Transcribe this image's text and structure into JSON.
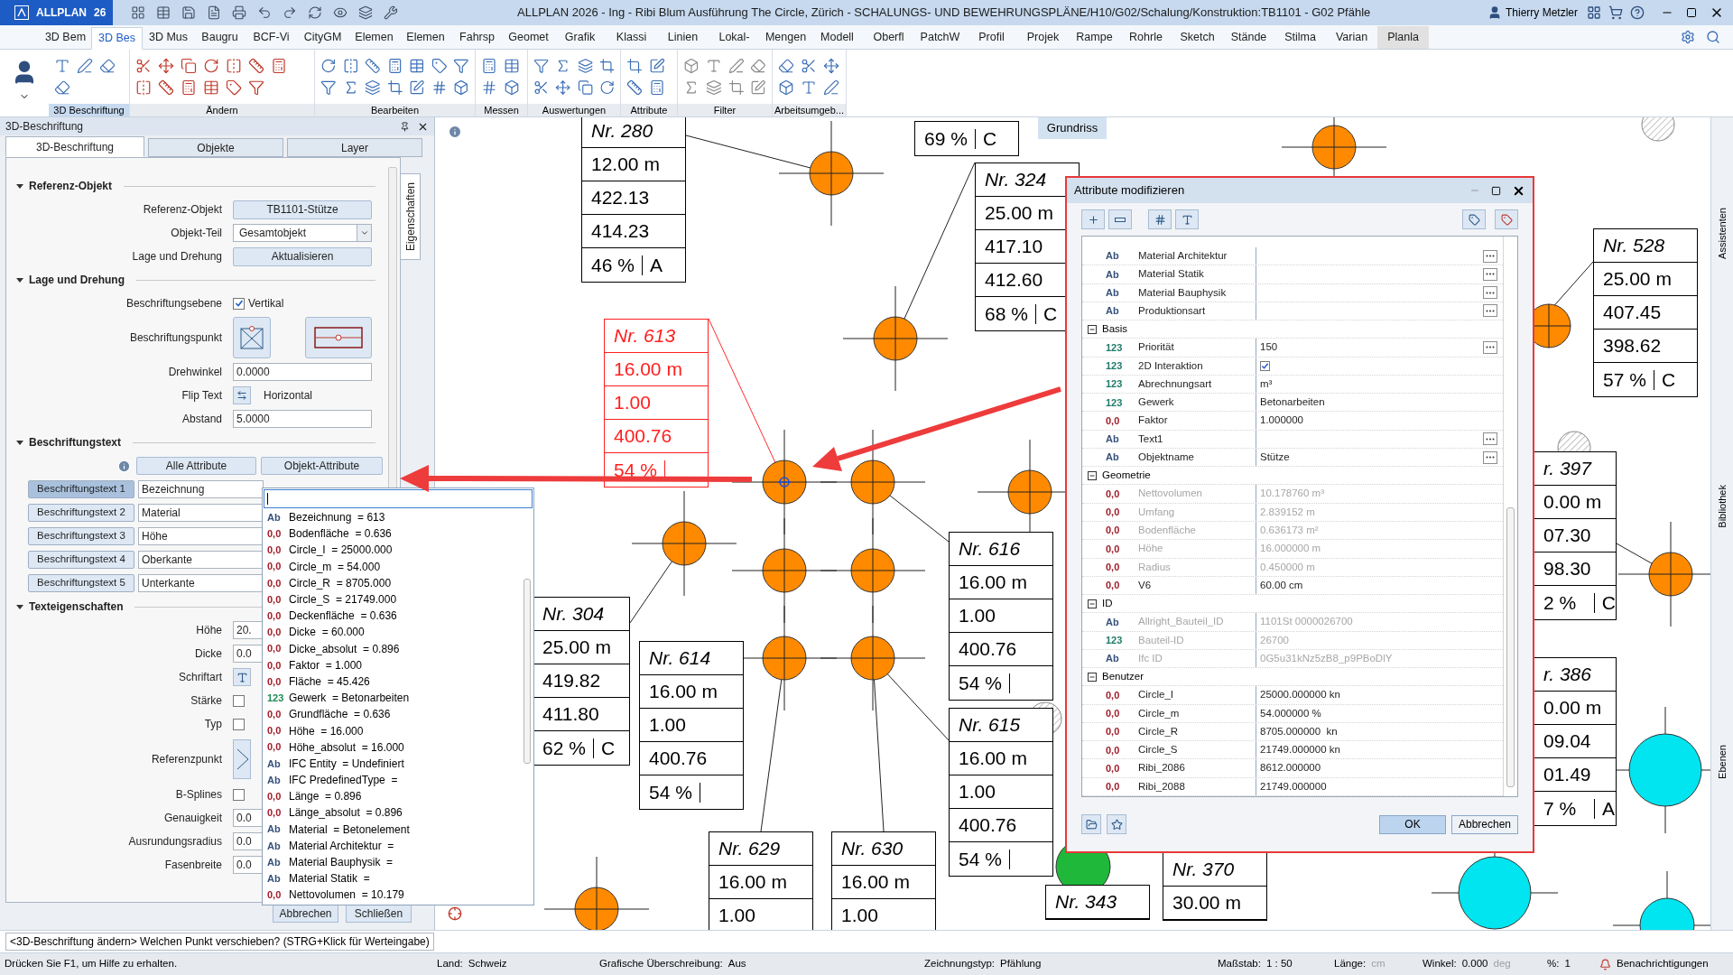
{
  "app": {
    "name": "ALLPLAN",
    "version": "26"
  },
  "window": {
    "title": "ALLPLAN 2026 - Ing - Ribi Blum Ausführung The Circle, Zürich - SCHALUNGS- UND BEWEHRUNGSPLÄNE/H10/G02/Schalung/Konstruktion:TB1101 - G02 Pfähle"
  },
  "user": {
    "name": "Thierry Metzler"
  },
  "ribbon": {
    "tabs": [
      {
        "label": "3D Bem",
        "selected": false,
        "highlighted": false
      },
      {
        "label": "3D Bes",
        "selected": true,
        "highlighted": false
      },
      {
        "label": "3D Mus",
        "selected": false,
        "highlighted": false
      },
      {
        "label": "Baugru",
        "selected": false,
        "highlighted": false
      },
      {
        "label": "BCF-Vi",
        "selected": false,
        "highlighted": false
      },
      {
        "label": "CityGM",
        "selected": false,
        "highlighted": false
      },
      {
        "label": "Elemen",
        "selected": false,
        "highlighted": false
      },
      {
        "label": "Elemen",
        "selected": false,
        "highlighted": false
      },
      {
        "label": "Fahrsp",
        "selected": false,
        "highlighted": false
      },
      {
        "label": "Geomet",
        "selected": false,
        "highlighted": false
      },
      {
        "label": "Grafik",
        "selected": false,
        "highlighted": false
      },
      {
        "label": "Klassi",
        "selected": false,
        "highlighted": false
      },
      {
        "label": "Linien",
        "selected": false,
        "highlighted": false
      },
      {
        "label": "Lokal-",
        "selected": false,
        "highlighted": false
      },
      {
        "label": "Mengen",
        "selected": false,
        "highlighted": false
      },
      {
        "label": "Modell",
        "selected": false,
        "highlighted": false
      },
      {
        "label": "Oberfl",
        "selected": false,
        "highlighted": false
      },
      {
        "label": "PatchW",
        "selected": false,
        "highlighted": false
      },
      {
        "label": "Profil",
        "selected": false,
        "highlighted": false
      },
      {
        "label": "Projek",
        "selected": false,
        "highlighted": false
      },
      {
        "label": "Rampe",
        "selected": false,
        "highlighted": false
      },
      {
        "label": "Rohrle",
        "selected": false,
        "highlighted": false
      },
      {
        "label": "Sketch",
        "selected": false,
        "highlighted": false
      },
      {
        "label": "Stände",
        "selected": false,
        "highlighted": false
      },
      {
        "label": "Stilma",
        "selected": false,
        "highlighted": false
      },
      {
        "label": "Varian",
        "selected": false,
        "highlighted": false
      },
      {
        "label": "Planla",
        "selected": false,
        "highlighted": true
      }
    ],
    "groups": [
      {
        "label": "3D Beschriftung",
        "selected": true
      },
      {
        "label": "Ändern",
        "selected": false
      },
      {
        "label": "Bearbeiten",
        "selected": false
      },
      {
        "label": "Messen",
        "selected": false
      },
      {
        "label": "Auswertungen",
        "selected": false
      },
      {
        "label": "Attribute",
        "selected": false
      },
      {
        "label": "Filter",
        "selected": false
      },
      {
        "label": "Arbeitsumgeb...",
        "selected": false
      }
    ]
  },
  "panel": {
    "title": "3D-Beschriftung",
    "side_tab": "Eigenschaften",
    "tabs": [
      {
        "label": "3D-Beschriftung",
        "selected": true
      },
      {
        "label": "Objekte",
        "selected": false
      },
      {
        "label": "Layer",
        "selected": false
      }
    ],
    "sections": [
      {
        "heading": "Referenz-Objekt",
        "expanded": true,
        "rows": [
          {
            "kind": "button",
            "label": "Referenz-Objekt",
            "value": "TB1101-Stütze"
          },
          {
            "kind": "select",
            "label": "Objekt-Teil",
            "value": "Gesamtobjekt"
          },
          {
            "kind": "button",
            "label": "Lage und Drehung",
            "value": "Aktualisieren"
          }
        ]
      },
      {
        "heading": "Lage und Drehung",
        "expanded": true,
        "rows": [
          {
            "kind": "check",
            "label": "Beschriftungsebene",
            "checked": true,
            "text": "Vertikal"
          },
          {
            "kind": "points",
            "label": "Beschriftungspunkt"
          },
          {
            "kind": "input",
            "label": "Drehwinkel",
            "value": "0.0000"
          },
          {
            "kind": "flip",
            "label": "Flip Text",
            "text": "Horizontal"
          },
          {
            "kind": "input",
            "label": "Abstand",
            "value": "5.0000"
          }
        ]
      },
      {
        "heading": "Beschriftungstext",
        "expanded": true,
        "rows": [
          {
            "kind": "attr_buttons",
            "buttons": [
              "Alle Attribute",
              "Objekt-Attribute"
            ]
          },
          {
            "kind": "slot",
            "label": "Beschriftungstext 1",
            "value": "Bezeichnung",
            "selected": true
          },
          {
            "kind": "slot",
            "label": "Beschriftungstext 2",
            "value": "Material",
            "selected": false
          },
          {
            "kind": "slot",
            "label": "Beschriftungstext 3",
            "value": "Höhe",
            "selected": false
          },
          {
            "kind": "slot",
            "label": "Beschriftungstext 4",
            "value": "Oberkante",
            "selected": false
          },
          {
            "kind": "slot",
            "label": "Beschriftungstext 5",
            "value": "Unterkante",
            "selected": false
          }
        ]
      },
      {
        "heading": "Texteigenschaften",
        "expanded": true,
        "rows": [
          {
            "kind": "input",
            "label": "Höhe",
            "value": "20."
          },
          {
            "kind": "input",
            "label": "Dicke",
            "value": "0.0"
          },
          {
            "kind": "font",
            "label": "Schriftart"
          },
          {
            "kind": "check",
            "label": "Stärke",
            "checked": false
          },
          {
            "kind": "check",
            "label": "Typ",
            "checked": false
          },
          {
            "kind": "refpoint",
            "label": "Referenzpunkt"
          },
          {
            "kind": "check",
            "label": "B-Splines",
            "checked": false
          },
          {
            "kind": "input",
            "label": "Genauigkeit",
            "value": "0.0"
          },
          {
            "kind": "input",
            "label": "Ausrundungsradius",
            "value": "0.0"
          },
          {
            "kind": "input",
            "label": "Fasenbreite",
            "value": "0.0"
          }
        ]
      }
    ],
    "footer_buttons": [
      "Abbrechen",
      "Schließen"
    ]
  },
  "dropdown": {
    "items": [
      {
        "color": "#34507a",
        "badge": "Ab",
        "text": "Bezeichnung  = 613"
      },
      {
        "color": "#a01d2a",
        "badge": "0,0",
        "text": "Bodenfläche  = 0.636"
      },
      {
        "color": "#a01d2a",
        "badge": "0,0",
        "text": "Circle_I  = 25000.000"
      },
      {
        "color": "#a01d2a",
        "badge": "0,0",
        "text": "Circle_m  = 54.000"
      },
      {
        "color": "#a01d2a",
        "badge": "0,0",
        "text": "Circle_R  = 8705.000"
      },
      {
        "color": "#a01d2a",
        "badge": "0,0",
        "text": "Circle_S  = 21749.000"
      },
      {
        "color": "#a01d2a",
        "badge": "0,0",
        "text": "Deckenfläche  = 0.636"
      },
      {
        "color": "#a01d2a",
        "badge": "0,0",
        "text": "Dicke  = 60.000"
      },
      {
        "color": "#a01d2a",
        "badge": "0,0",
        "text": "Dicke_absolut  = 0.896"
      },
      {
        "color": "#a01d2a",
        "badge": "0,0",
        "text": "Faktor  = 1.000"
      },
      {
        "color": "#a01d2a",
        "badge": "0,0",
        "text": "Fläche  = 45.426"
      },
      {
        "color": "#1f8a55",
        "badge": "123",
        "text": "Gewerk  = Betonarbeiten"
      },
      {
        "color": "#a01d2a",
        "badge": "0,0",
        "text": "Grundfläche  = 0.636"
      },
      {
        "color": "#a01d2a",
        "badge": "0,0",
        "text": "Höhe  = 16.000"
      },
      {
        "color": "#a01d2a",
        "badge": "0,0",
        "text": "Höhe_absolut  = 16.000"
      },
      {
        "color": "#34507a",
        "badge": "Ab",
        "text": "IFC Entity  = Undefiniert"
      },
      {
        "color": "#34507a",
        "badge": "Ab",
        "text": "IFC PredefinedType  ="
      },
      {
        "color": "#a01d2a",
        "badge": "0,0",
        "text": "Länge  = 0.896"
      },
      {
        "color": "#a01d2a",
        "badge": "0,0",
        "text": "Länge_absolut  = 0.896"
      },
      {
        "color": "#34507a",
        "badge": "Ab",
        "text": "Material  = Betonelement"
      },
      {
        "color": "#34507a",
        "badge": "Ab",
        "text": "Material Architektur  ="
      },
      {
        "color": "#34507a",
        "badge": "Ab",
        "text": "Material Bauphysik  ="
      },
      {
        "color": "#34507a",
        "badge": "Ab",
        "text": "Material Statik  ="
      },
      {
        "color": "#a01d2a",
        "badge": "0,0",
        "text": "Nettovolumen  = 10.179"
      }
    ]
  },
  "canvas": {
    "view_label": "Grundriss",
    "labels": [
      {
        "rows": [
          "Nr. 280",
          "12.00 m",
          "422.13",
          "414.23"
        ],
        "percent": "46 %",
        "code": "A",
        "selected": false
      },
      {
        "percent": "69 %",
        "code": "C",
        "selected": false
      },
      {
        "rows": [
          "Nr. 324",
          "25.00 m",
          "417.10",
          "412.60"
        ],
        "percent": "68 %",
        "code": "C",
        "selected": false
      },
      {
        "rows": [
          "Nr. 613",
          "16.00 m",
          "1.00",
          "400.76"
        ],
        "percent": "54 %",
        "selected": true
      },
      {
        "rows": [
          "Nr. 616",
          "16.00 m",
          "1.00",
          "400.76"
        ],
        "percent": "54 %",
        "selected": false
      },
      {
        "rows": [
          "Nr. 615",
          "16.00 m",
          "1.00",
          "400.76"
        ],
        "percent": "54 %",
        "selected": false
      },
      {
        "rows": [
          "Nr. 304",
          "25.00 m",
          "419.82",
          "411.80"
        ],
        "percent": "62 %",
        "code": "C",
        "selected": false
      },
      {
        "rows": [
          "Nr. 614",
          "16.00 m",
          "1.00",
          "400.76"
        ],
        "percent": "54 %",
        "selected": false
      },
      {
        "rows": [
          "Nr. 629",
          "16.00 m",
          "1.00"
        ],
        "selected": false
      },
      {
        "rows": [
          "Nr. 630",
          "16.00 m",
          "1.00"
        ],
        "selected": false
      },
      {
        "rows": [
          "Nr. 343"
        ],
        "selected": false
      },
      {
        "rows": [
          "Nr. 370",
          "30.00 m"
        ],
        "selected": false
      },
      {
        "rows": [
          "Nr. 528",
          "25.00 m",
          "407.45",
          "398.62"
        ],
        "percent": "57 %",
        "code": "C",
        "selected": false
      },
      {
        "rows": [
          "r. 397",
          "0.00 m",
          "07.30",
          "98.30"
        ],
        "percent": "2 %",
        "code": "C",
        "selected": false
      },
      {
        "rows": [
          "r. 386",
          "0.00 m",
          "09.04",
          "01.49"
        ],
        "percent": "7 %",
        "code": "A",
        "selected": false
      }
    ]
  },
  "dialog": {
    "title": "Attribute modifizieren",
    "rows": [
      {
        "kind": "attr",
        "color": "#34507a",
        "badge": "Ab",
        "name": "Material Architektur",
        "disabled": false,
        "more": true
      },
      {
        "kind": "attr",
        "color": "#34507a",
        "badge": "Ab",
        "name": "Material Statik",
        "disabled": false,
        "more": true
      },
      {
        "kind": "attr",
        "color": "#34507a",
        "badge": "Ab",
        "name": "Material Bauphysik",
        "disabled": false,
        "more": true
      },
      {
        "kind": "attr",
        "color": "#34507a",
        "badge": "Ab",
        "name": "Produktionsart",
        "disabled": false,
        "more": true
      },
      {
        "kind": "group",
        "label": "Basis",
        "expanded": true
      },
      {
        "kind": "attr",
        "color": "#1f7a6a",
        "badge": "123",
        "name": "Priorität",
        "value": "150",
        "disabled": false,
        "more": true
      },
      {
        "kind": "check",
        "color": "#1f7a6a",
        "badge": "123",
        "name": "2D Interaktion",
        "checked": true,
        "disabled": false,
        "more": false
      },
      {
        "kind": "attr",
        "color": "#1f7a6a",
        "badge": "123",
        "name": "Abrechnungsart",
        "value": "m³",
        "disabled": false,
        "more": false
      },
      {
        "kind": "attr",
        "color": "#1f7a6a",
        "badge": "123",
        "name": "Gewerk",
        "value": "Betonarbeiten",
        "disabled": false,
        "more": false
      },
      {
        "kind": "attr",
        "color": "#a01d2a",
        "badge": "0,0",
        "name": "Faktor",
        "value": "1.000000",
        "disabled": false,
        "more": false
      },
      {
        "kind": "attr",
        "color": "#34507a",
        "badge": "Ab",
        "name": "Text1",
        "disabled": false,
        "more": true
      },
      {
        "kind": "attr",
        "color": "#34507a",
        "badge": "Ab",
        "name": "Objektname",
        "value": "Stütze",
        "disabled": false,
        "more": true
      },
      {
        "kind": "group",
        "label": "Geometrie",
        "expanded": true
      },
      {
        "kind": "attr",
        "color": "#a01d2a",
        "badge": "0,0",
        "name": "Nettovolumen",
        "value": "10.178760 m³",
        "disabled": true,
        "more": false
      },
      {
        "kind": "attr",
        "color": "#a01d2a",
        "badge": "0,0",
        "name": "Umfang",
        "value": "2.839152 m",
        "disabled": true,
        "more": false
      },
      {
        "kind": "attr",
        "color": "#a01d2a",
        "badge": "0,0",
        "name": "Bodenfläche",
        "value": "0.636173 m²",
        "disabled": true,
        "more": false
      },
      {
        "kind": "attr",
        "color": "#a01d2a",
        "badge": "0,0",
        "name": "Höhe",
        "value": "16.000000 m",
        "disabled": true,
        "more": false
      },
      {
        "kind": "attr",
        "color": "#a01d2a",
        "badge": "0,0",
        "name": "Radius",
        "value": "0.450000 m",
        "disabled": true,
        "more": false
      },
      {
        "kind": "attr",
        "color": "#a01d2a",
        "badge": "0,0",
        "name": "V6",
        "value": "60.00 cm",
        "disabled": false,
        "more": false
      },
      {
        "kind": "group",
        "label": "ID",
        "expanded": true
      },
      {
        "kind": "attr",
        "color": "#34507a",
        "badge": "Ab",
        "name": "Allright_Bauteil_ID",
        "value": "1101St 0000026700",
        "disabled": true,
        "more": false
      },
      {
        "kind": "attr",
        "color": "#1f7a6a",
        "badge": "123",
        "name": "Bauteil-ID",
        "value": "26700",
        "disabled": true,
        "more": false
      },
      {
        "kind": "attr",
        "color": "#34507a",
        "badge": "Ab",
        "name": "Ifc ID",
        "value": "0G5u31kNz5zB8_p9PBoDlY",
        "disabled": true,
        "more": false
      },
      {
        "kind": "group",
        "label": "Benutzer",
        "expanded": true
      },
      {
        "kind": "attr",
        "color": "#a01d2a",
        "badge": "0,0",
        "name": "Circle_I",
        "value": "25000.000000 kn",
        "disabled": false,
        "more": false
      },
      {
        "kind": "attr",
        "color": "#a01d2a",
        "badge": "0,0",
        "name": "Circle_m",
        "value": "54.000000 %",
        "disabled": false,
        "more": false
      },
      {
        "kind": "attr",
        "color": "#a01d2a",
        "badge": "0,0",
        "name": "Circle_R",
        "value": "8705.000000  kn",
        "disabled": false,
        "more": false
      },
      {
        "kind": "attr",
        "color": "#a01d2a",
        "badge": "0,0",
        "name": "Circle_S",
        "value": "21749.000000 kn",
        "disabled": false,
        "more": false
      },
      {
        "kind": "attr",
        "color": "#a01d2a",
        "badge": "0,0",
        "name": "Ribi_2086",
        "value": "8612.000000",
        "disabled": false,
        "more": false
      },
      {
        "kind": "attr",
        "color": "#a01d2a",
        "badge": "0,0",
        "name": "Ribi_2088",
        "value": "21749.000000",
        "disabled": false,
        "more": false
      }
    ],
    "buttons": [
      "OK",
      "Abbrechen"
    ]
  },
  "side_tabs": [
    "Assistenten",
    "Bibliothek",
    "Ebenen"
  ],
  "command_line": "<3D-Beschriftung ändern> Welchen Punkt verschieben? (STRG+Klick für Werteingabe)",
  "status_bar": [
    {
      "label": "Drücken Sie F1, um Hilfe zu erhalten."
    },
    {
      "label": "Land:",
      "value": "Schweiz"
    },
    {
      "label": "Grafische Überschreibung:",
      "value": "Aus"
    },
    {
      "label": "Zeichnungstyp:",
      "value": "Pfählung"
    },
    {
      "label": "Maßstab:",
      "value": "1 : 50"
    },
    {
      "label": "Länge:",
      "unit": "cm"
    },
    {
      "label": "Winkel:",
      "value": "0.000",
      "unit": "deg"
    },
    {
      "label": "%:",
      "value": "1"
    },
    {
      "label": "Benachrichtigungen",
      "kind": "notify"
    }
  ]
}
